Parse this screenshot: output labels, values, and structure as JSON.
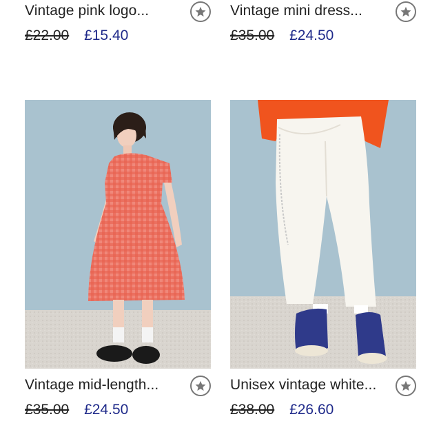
{
  "products": [
    {
      "title": "Vintage pink logo...",
      "old_price": "£22.00",
      "sale_price": "£15.40"
    },
    {
      "title": "Vintage mini dress...",
      "old_price": "£35.00",
      "sale_price": "£24.50"
    },
    {
      "title": "Vintage mid-length...",
      "old_price": "£35.00",
      "sale_price": "£24.50",
      "image": "woman-in-red-gingham-dress"
    },
    {
      "title": "Unisex vintage white...",
      "old_price": "£38.00",
      "sale_price": "£26.60",
      "image": "white-trousers-blue-sneakers"
    }
  ],
  "icons": {
    "favorite": "star-icon"
  },
  "colors": {
    "sale_price": "#1f2a8a",
    "text": "#222222",
    "icon_border": "#777777",
    "photo_backdrop": "#a9c2cf"
  }
}
